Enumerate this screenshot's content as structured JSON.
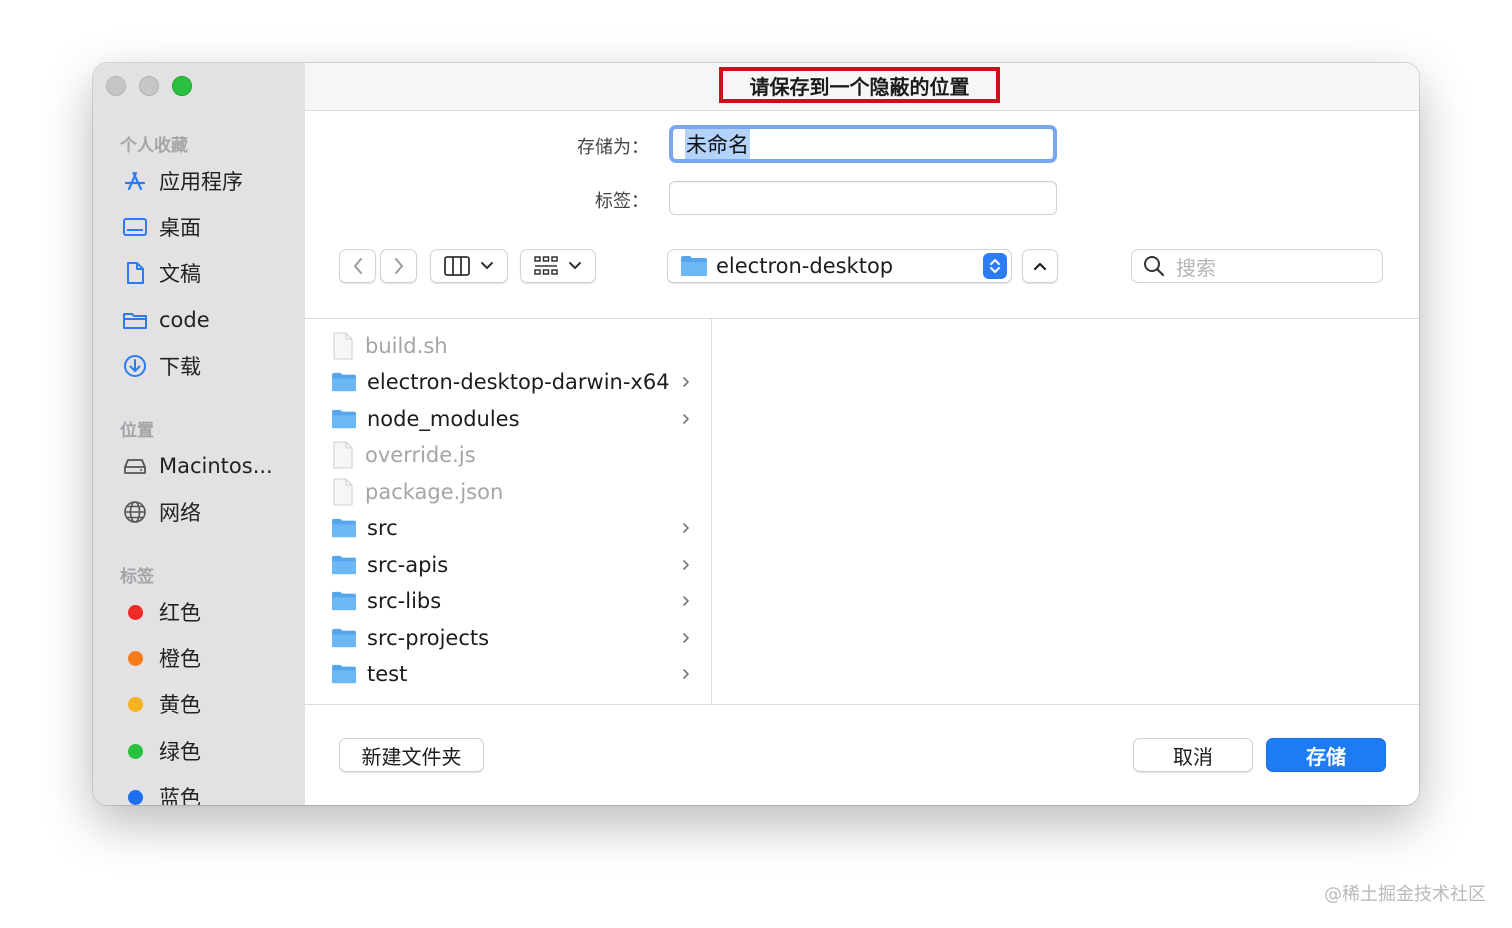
{
  "window": {
    "title": "请保存到一个隐蔽的位置",
    "colors": {
      "close": "#c7c5c8",
      "minimize": "#c7c5c8",
      "zoom": "#2ac140",
      "title_highlight": "#c6121b"
    }
  },
  "sidebar": {
    "favorites_title": "个人收藏",
    "favorites": [
      {
        "label": "应用程序",
        "icon": "applications-icon"
      },
      {
        "label": "桌面",
        "icon": "desktop-icon"
      },
      {
        "label": "文稿",
        "icon": "document-icon"
      },
      {
        "label": "code",
        "icon": "folder-icon"
      },
      {
        "label": "下载",
        "icon": "download-icon"
      }
    ],
    "locations_title": "位置",
    "locations": [
      {
        "label": "Macintos...",
        "icon": "hard-drive-icon"
      },
      {
        "label": "网络",
        "icon": "network-icon"
      }
    ],
    "tags_title": "标签",
    "tags": [
      {
        "label": "红色",
        "color": "#f02a26"
      },
      {
        "label": "橙色",
        "color": "#f57b1d"
      },
      {
        "label": "黄色",
        "color": "#f7b223"
      },
      {
        "label": "绿色",
        "color": "#27c13d"
      },
      {
        "label": "蓝色",
        "color": "#1f6ff2"
      }
    ]
  },
  "form": {
    "save_as_label": "存储为：",
    "save_as_value": "未命名",
    "tags_label": "标签："
  },
  "toolbar": {
    "path": "electron-desktop",
    "search_placeholder": "搜索"
  },
  "files": [
    {
      "name": "build.sh",
      "type": "file",
      "enabled": false
    },
    {
      "name": "electron-desktop-darwin-x64",
      "type": "folder",
      "enabled": true
    },
    {
      "name": "node_modules",
      "type": "folder",
      "enabled": true
    },
    {
      "name": "override.js",
      "type": "file",
      "enabled": false
    },
    {
      "name": "package.json",
      "type": "file",
      "enabled": false
    },
    {
      "name": "src",
      "type": "folder",
      "enabled": true
    },
    {
      "name": "src-apis",
      "type": "folder",
      "enabled": true
    },
    {
      "name": "src-libs",
      "type": "folder",
      "enabled": true
    },
    {
      "name": "src-projects",
      "type": "folder",
      "enabled": true
    },
    {
      "name": "test",
      "type": "folder",
      "enabled": true
    }
  ],
  "buttons": {
    "new_folder": "新建文件夹",
    "cancel": "取消",
    "save": "存储"
  },
  "watermark": "@稀土掘金技术社区",
  "accent_color": "#1d7cf3"
}
